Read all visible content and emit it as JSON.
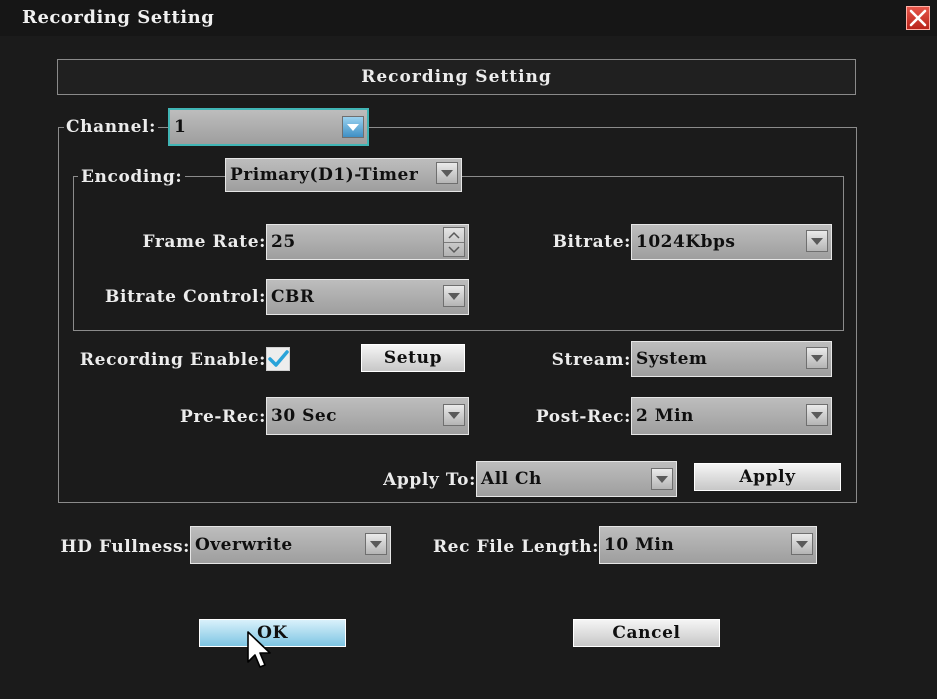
{
  "window": {
    "title": "Recording Setting"
  },
  "header": {
    "title": "Recording Setting"
  },
  "channel": {
    "label": "Channel:",
    "value": "1"
  },
  "encoding": {
    "label": "Encoding:",
    "value": "Primary(D1)-Timer"
  },
  "frame_rate": {
    "label": "Frame Rate:",
    "value": "25"
  },
  "bitrate": {
    "label": "Bitrate:",
    "value": "1024Kbps"
  },
  "bitrate_control": {
    "label": "Bitrate Control:",
    "value": "CBR"
  },
  "recording_enable": {
    "label": "Recording Enable:",
    "checked": true
  },
  "setup_button": {
    "label": "Setup"
  },
  "stream": {
    "label": "Stream:",
    "value": "System"
  },
  "pre_rec": {
    "label": "Pre-Rec:",
    "value": "30 Sec"
  },
  "post_rec": {
    "label": "Post-Rec:",
    "value": "2 Min"
  },
  "apply_to": {
    "label": "Apply To:",
    "value": "All Ch"
  },
  "apply_button": {
    "label": "Apply"
  },
  "hd_fullness": {
    "label": "HD Fullness:",
    "value": "Overwrite"
  },
  "rec_file_length": {
    "label": "Rec File Length:",
    "value": "10 Min"
  },
  "footer": {
    "ok_label": "OK",
    "cancel_label": "Cancel"
  },
  "icons": {
    "close": "close-icon",
    "dropdown": "chevron-down-icon",
    "spinner": "spinner-arrows-icon",
    "check": "checkmark-icon",
    "cursor": "mouse-pointer-icon"
  },
  "colors": {
    "background": "#1b1b1b",
    "field": "#b0b0b0",
    "ok_button": "#9fd8ee",
    "checkmark": "#29a3d9",
    "close": "#d63a2e",
    "active_border": "#41b5b5"
  }
}
